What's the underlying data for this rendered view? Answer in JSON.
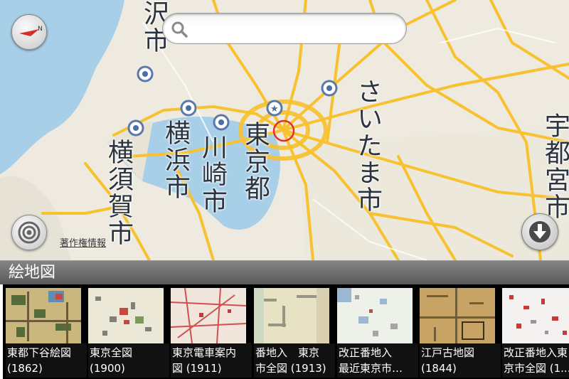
{
  "map": {
    "city_labels": [
      "沢市",
      "横浜市",
      "横須賀市",
      "川崎市",
      "東京都",
      "さいたま市",
      "宇都宮市"
    ],
    "copyright_link": "著作権情報",
    "colors": {
      "sea": "#a8cfe8",
      "land": "#eeeadf",
      "road": "#f7c12f",
      "poi": "#4a6fa5",
      "current_location": "#e0312d"
    }
  },
  "search": {
    "placeholder": "",
    "value": ""
  },
  "panel": {
    "title": "絵地図",
    "maps": [
      {
        "line1": "東都下谷絵図",
        "line2": "(1862)"
      },
      {
        "line1": "東京全図",
        "line2": "(1900)"
      },
      {
        "line1": "東京電車案内",
        "line2": "図 (1911)"
      },
      {
        "line1": "番地入　東京",
        "line2": "市全図 (1913)"
      },
      {
        "line1": "改正番地入",
        "line2": "最近東京市…"
      },
      {
        "line1": "江戸古地図",
        "line2": "(1844)"
      },
      {
        "line1": "改正番地入東",
        "line2": "京市全図 (1..."
      }
    ]
  }
}
